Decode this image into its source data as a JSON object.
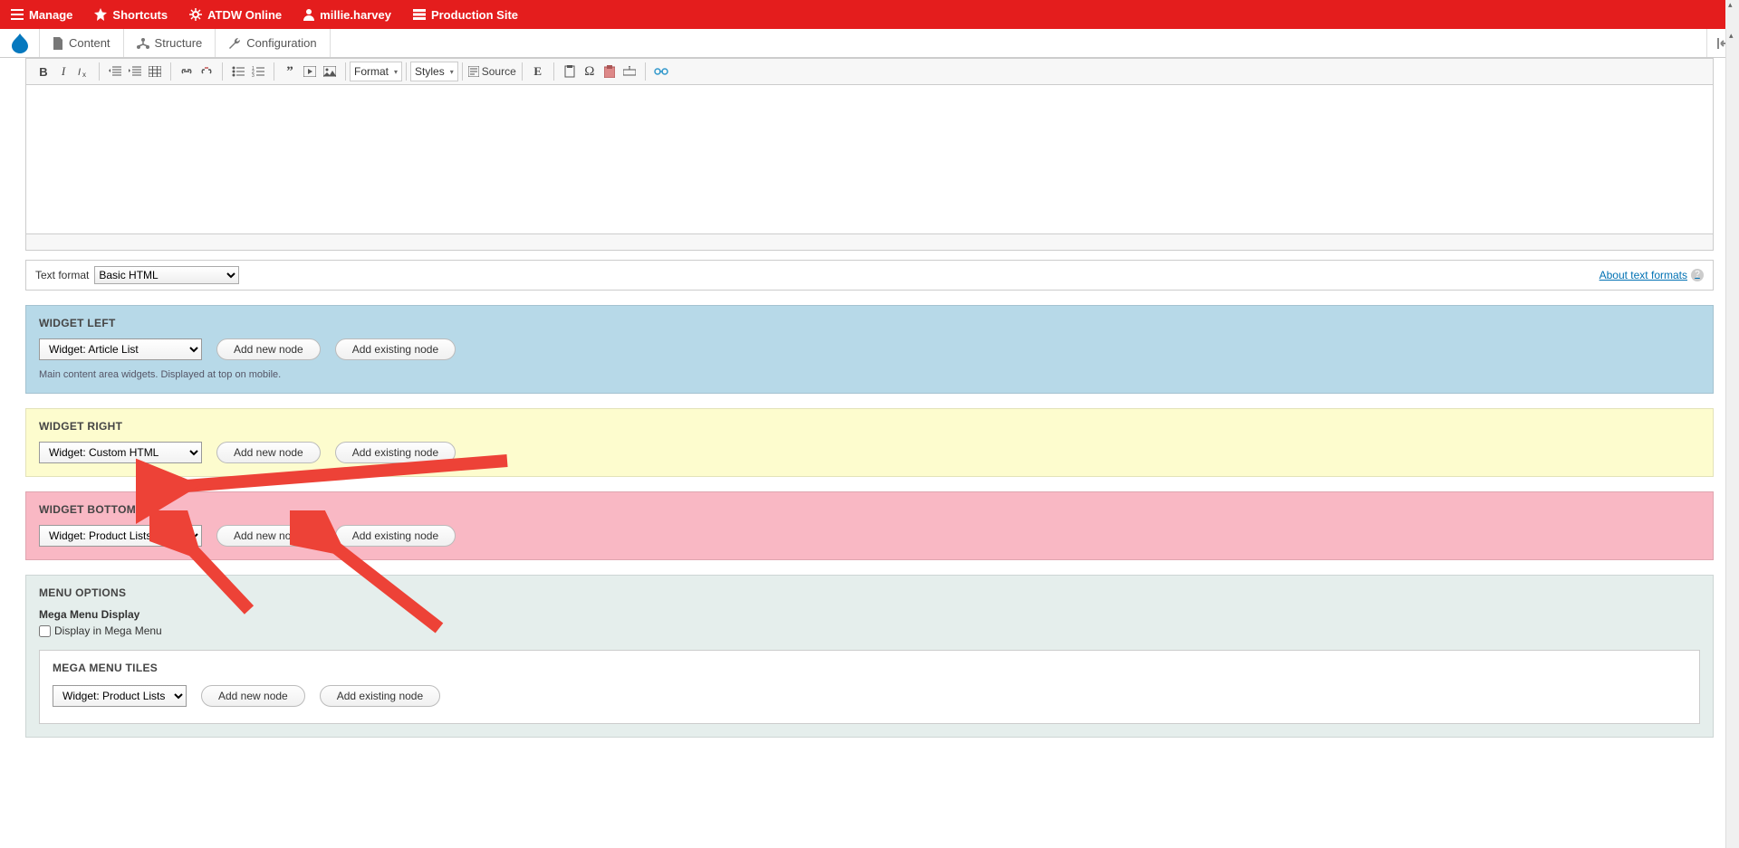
{
  "toolbar": {
    "manage": "Manage",
    "shortcuts": "Shortcuts",
    "atdw": "ATDW Online",
    "user": "millie.harvey",
    "site": "Production Site"
  },
  "admin": {
    "content": "Content",
    "structure": "Structure",
    "configuration": "Configuration"
  },
  "editor": {
    "format_dropdown": "Format",
    "styles_dropdown": "Styles",
    "source": "Source"
  },
  "text_format": {
    "label": "Text format",
    "value": "Basic HTML",
    "about": "About text formats"
  },
  "widget_left": {
    "title": "WIDGET LEFT",
    "select": "Widget: Article List",
    "add_new": "Add new node",
    "add_existing": "Add existing node",
    "help": "Main content area widgets. Displayed at top on mobile."
  },
  "widget_right": {
    "title": "WIDGET RIGHT",
    "select": "Widget: Custom HTML",
    "add_new": "Add new node",
    "add_existing": "Add existing node"
  },
  "widget_bottom": {
    "title": "WIDGET BOTTOM",
    "select": "Widget: Product Lists",
    "add_new": "Add new node",
    "add_existing": "Add existing node"
  },
  "menu_options": {
    "title": "MENU OPTIONS",
    "display_label": "Mega Menu Display",
    "checkbox_label": "Display in Mega Menu",
    "tiles_title": "MEGA MENU TILES",
    "tiles_select": "Widget: Product Lists",
    "tiles_add_new": "Add new node",
    "tiles_add_existing": "Add existing node"
  }
}
